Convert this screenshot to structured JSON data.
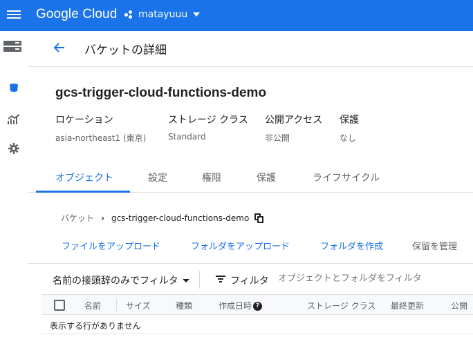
{
  "topbar": {
    "brand": "Google Cloud",
    "project": "matayuuu"
  },
  "header": {
    "title": "バケットの詳細"
  },
  "bucket": {
    "name": "gcs-trigger-cloud-functions-demo",
    "meta": [
      {
        "key": "ロケーション",
        "value": "asia-northeast1 (東京)"
      },
      {
        "key": "ストレージ クラス",
        "value": "Standard"
      },
      {
        "key": "公開アクセス",
        "value": "非公開"
      },
      {
        "key": "保護",
        "value": "なし"
      }
    ]
  },
  "tabs": [
    "オブジェクト",
    "設定",
    "権限",
    "保護",
    "ライフサイクル"
  ],
  "breadcrumb": {
    "root": "バケット",
    "current": "gcs-trigger-cloud-functions-demo"
  },
  "actions": [
    "ファイルをアップロード",
    "フォルダをアップロード",
    "フォルダを作成",
    "保留を管理"
  ],
  "filter": {
    "prefix_select": "名前の接頭辞のみでフィルタ",
    "label": "フィルタ",
    "placeholder": "オブジェクトとフォルダをフィルタ"
  },
  "table": {
    "columns": [
      "名前",
      "サイズ",
      "種類",
      "作成日時",
      "ストレージ クラス",
      "最終更新",
      "公開"
    ],
    "empty_text": "表示する行がありません"
  },
  "colors": {
    "accent": "#1a73e8",
    "text": "#202124",
    "muted": "#5f6368"
  }
}
